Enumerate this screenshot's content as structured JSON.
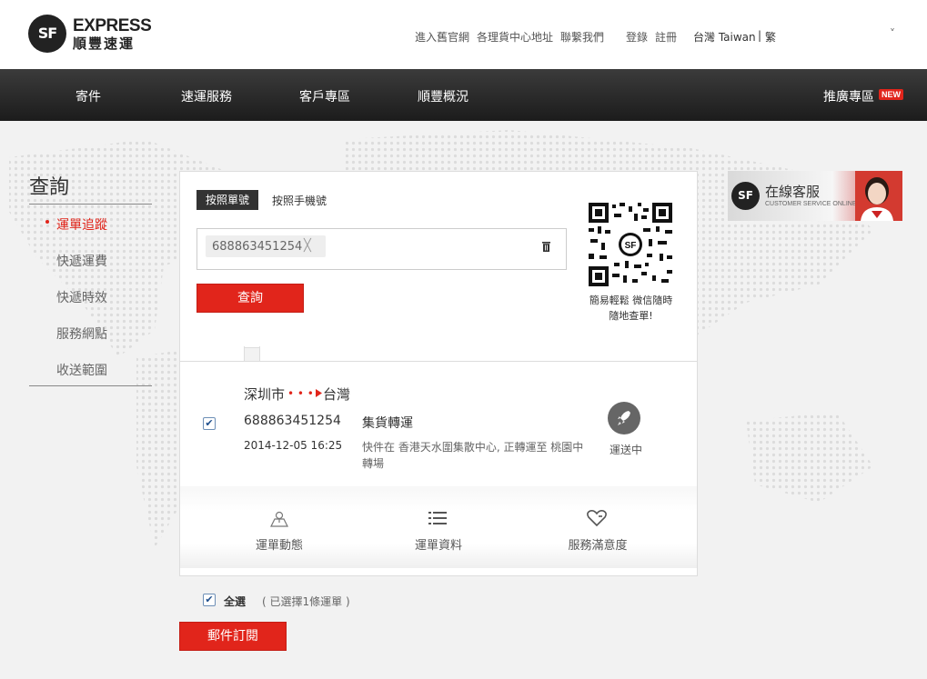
{
  "brand": {
    "mark": "SF",
    "en": "EXPRESS",
    "cn": "順豐速運"
  },
  "header": {
    "links": [
      "進入舊官網",
      "各理貨中心地址",
      "聯繫我們"
    ],
    "login": "登錄",
    "register": "註冊",
    "region": "台灣 Taiwan",
    "region_sep": "|",
    "lang": "繁",
    "dropdown_icon": "˅"
  },
  "nav": {
    "items": [
      "寄件",
      "速運服務",
      "客戶專區",
      "順豐概況"
    ],
    "promo": "推廣專區",
    "promo_badge": "NEW"
  },
  "sidebar": {
    "title": "查詢",
    "items": [
      "運單追蹤",
      "快遞運費",
      "快遞時效",
      "服務網點",
      "收送範圍"
    ],
    "active": "運單追蹤"
  },
  "search": {
    "tab_by_waybill": "按照單號",
    "tab_by_phone": "按照手機號",
    "chip_value": "688863451254",
    "chip_remove": "╳",
    "submit_label": "查詢",
    "qr_caption_1": "簡易輕鬆 微信隨時",
    "qr_caption_2": "隨地查單!"
  },
  "customer_service": {
    "mark": "SF",
    "title": "在線客服",
    "subtitle": "CUSTOMER SERVICE ONLINE"
  },
  "result": {
    "origin": "深圳市",
    "destination": "台灣",
    "waybill": "688863451254",
    "checked": "✔",
    "time": "2014-12-05 16:25",
    "event_title": "集貨轉運",
    "event_desc_1": "快件在 香港天水圍集散中心, 正轉運至 桃園中",
    "event_desc_2": "轉場",
    "status": "運送中"
  },
  "actions": {
    "dynamic": "運單動態",
    "info": "運單資料",
    "satisfaction": "服務滿意度"
  },
  "footer": {
    "select_all": "全選",
    "selected_count": "( 已選擇1條運單 )",
    "checked": "✔",
    "subscribe_label": "郵件訂閱"
  },
  "colors": {
    "brand_red": "#e1251b",
    "nav_dark": "#2a2a2a",
    "bg": "#f2f2f2"
  }
}
